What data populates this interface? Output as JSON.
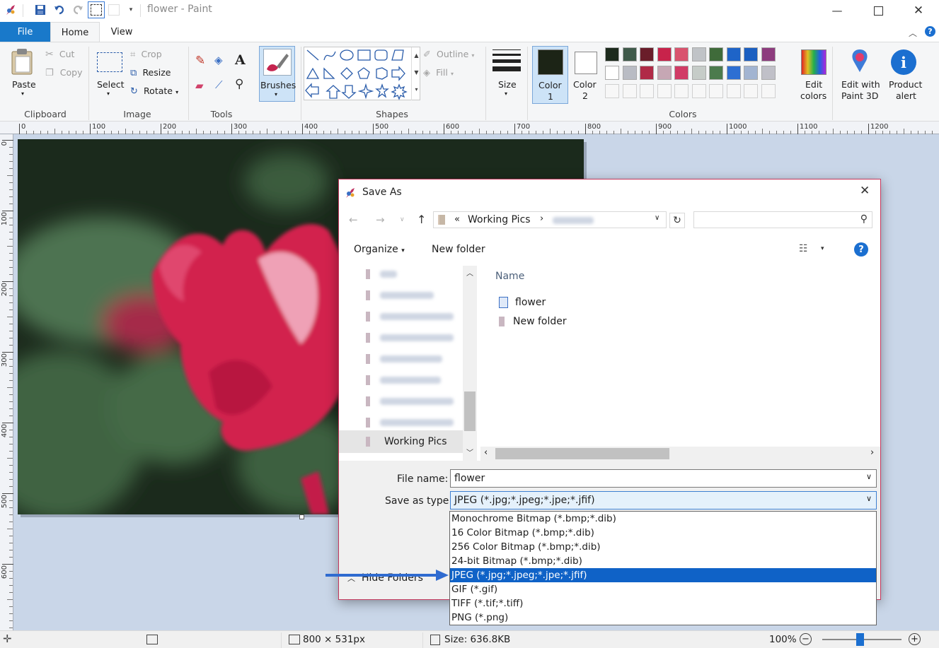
{
  "window": {
    "title": "flower - Paint"
  },
  "tabs": {
    "file": "File",
    "home": "Home",
    "view": "View"
  },
  "clipboard": {
    "paste": "Paste",
    "cut": "Cut",
    "copy": "Copy",
    "group": "Clipboard"
  },
  "image": {
    "select": "Select",
    "crop": "Crop",
    "resize": "Resize",
    "rotate": "Rotate",
    "group": "Image"
  },
  "tools": {
    "group": "Tools"
  },
  "brushes": {
    "label": "Brushes"
  },
  "shapes": {
    "outline": "Outline",
    "fill": "Fill",
    "group": "Shapes"
  },
  "size": {
    "label": "Size"
  },
  "colors": {
    "color1": "Color",
    "color1_num": "1",
    "color2": "Color",
    "color2_num": "2",
    "group": "Colors",
    "edit": "Edit",
    "edit2": "colors",
    "paint3d": "Edit with",
    "paint3d2": "Paint 3D",
    "alert": "Product",
    "alert2": "alert",
    "color1_value": "#1c2416",
    "palette": [
      "#1c2a1c",
      "#3f5a4a",
      "#6a1d2a",
      "#c8234b",
      "#d9536e",
      "#c0c3c7",
      "#3f6b3a",
      "#1e64c8",
      "#1b5fc1",
      "#8d3c7e",
      "#ffffff",
      "#b9bcc4",
      "#b02a47",
      "#c6a7b4",
      "#d13c66",
      "#c6ccc8",
      "#4c7b4d",
      "#2d6fd3",
      "#a2b4d1",
      "#c0c0c8"
    ]
  },
  "ruler": {
    "h": [
      "0",
      "100",
      "200",
      "300",
      "400",
      "500",
      "600",
      "700",
      "800",
      "900",
      "1000",
      "1100",
      "1200"
    ],
    "v": [
      "0",
      "100",
      "200",
      "300",
      "400",
      "500",
      "600"
    ]
  },
  "dialog": {
    "title": "Save As",
    "path_prefix": "«",
    "path": "Working Pics",
    "path_sep": "›",
    "organize": "Organize",
    "new_folder": "New folder",
    "nav_selected": "Working Pics",
    "col_name": "Name",
    "files": [
      "flower",
      "New folder"
    ],
    "file_name_label": "File name:",
    "file_name_value": "flower",
    "type_label": "Save as type:",
    "type_value": "JPEG (*.jpg;*.jpeg;*.jpe;*.jfif)",
    "hide_folders": "Hide Folders",
    "type_options": [
      "Monochrome Bitmap (*.bmp;*.dib)",
      "16 Color Bitmap (*.bmp;*.dib)",
      "256 Color Bitmap (*.bmp;*.dib)",
      "24-bit Bitmap (*.bmp;*.dib)",
      "JPEG (*.jpg;*.jpeg;*.jpe;*.jfif)",
      "GIF (*.gif)",
      "TIFF (*.tif;*.tiff)",
      "PNG (*.png)"
    ]
  },
  "status": {
    "dimensions": "800 × 531px",
    "size": "Size: 636.8KB",
    "zoom": "100%"
  }
}
